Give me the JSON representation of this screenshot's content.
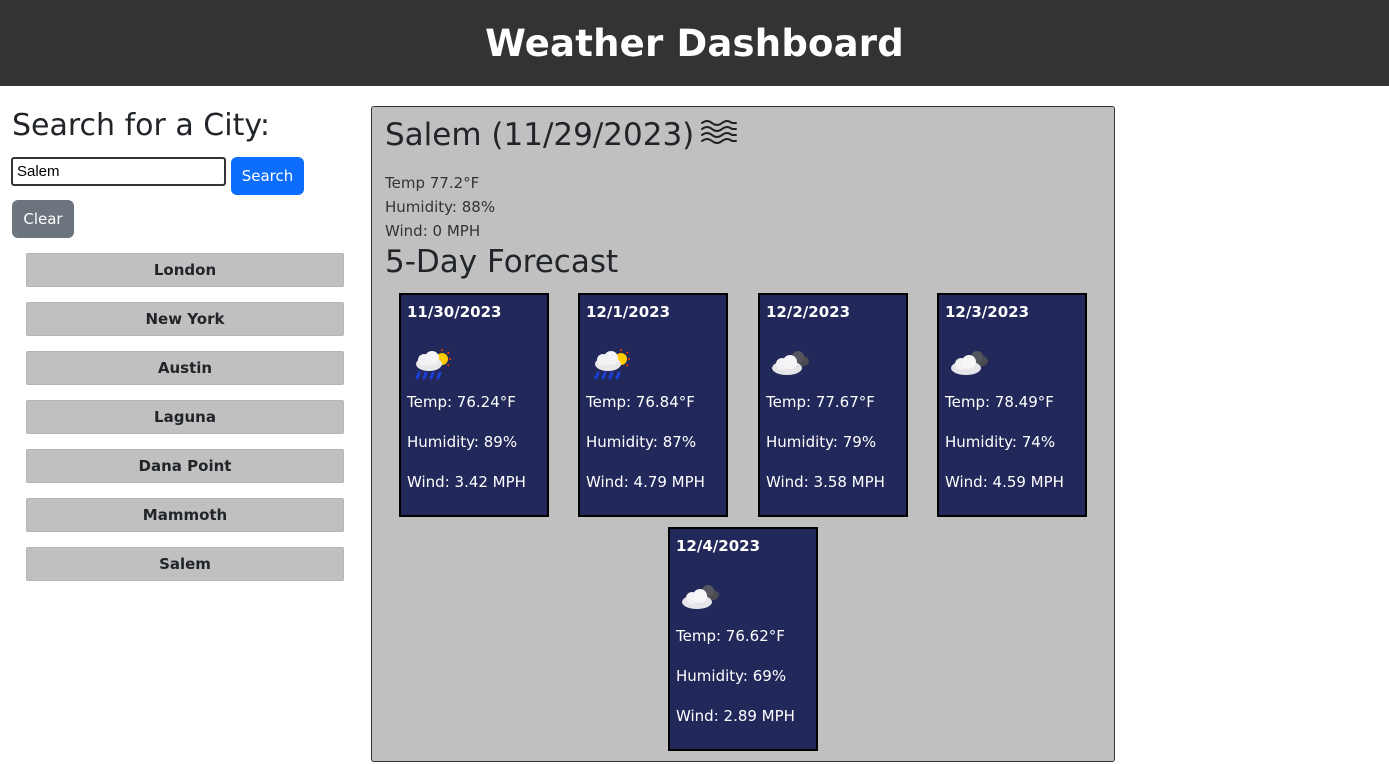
{
  "header": {
    "title": "Weather Dashboard"
  },
  "search": {
    "title": "Search for a City:",
    "input_value": "Salem",
    "search_label": "Search",
    "clear_label": "Clear"
  },
  "history": [
    "London",
    "New York",
    "Austin",
    "Laguna",
    "Dana Point",
    "Mammoth",
    "Salem"
  ],
  "current": {
    "heading": "Salem (11/29/2023)",
    "icon": "mist-icon",
    "temp": "Temp 77.2°F",
    "humidity": "Humidity: 88%",
    "wind": "Wind: 0 MPH"
  },
  "forecast_title": "5-Day Forecast",
  "forecast": [
    {
      "date": "11/30/2023",
      "icon": "rain-sun-icon",
      "temp": "Temp: 76.24°F",
      "humidity": "Humidity: 89%",
      "wind": "Wind: 3.42 MPH"
    },
    {
      "date": "12/1/2023",
      "icon": "rain-sun-icon",
      "temp": "Temp: 76.84°F",
      "humidity": "Humidity: 87%",
      "wind": "Wind: 4.79 MPH"
    },
    {
      "date": "12/2/2023",
      "icon": "broken-clouds-icon",
      "temp": "Temp: 77.67°F",
      "humidity": "Humidity: 79%",
      "wind": "Wind: 3.58 MPH"
    },
    {
      "date": "12/3/2023",
      "icon": "broken-clouds-icon",
      "temp": "Temp: 78.49°F",
      "humidity": "Humidity: 74%",
      "wind": "Wind: 4.59 MPH"
    },
    {
      "date": "12/4/2023",
      "icon": "broken-clouds-icon",
      "temp": "Temp: 76.62°F",
      "humidity": "Humidity: 69%",
      "wind": "Wind: 2.89 MPH"
    }
  ],
  "colors": {
    "header_bg": "#333333",
    "panel_bg": "#c0c0c0",
    "card_bg": "#22285a",
    "search_button": "#0d6efd",
    "clear_button": "#6c757d"
  }
}
